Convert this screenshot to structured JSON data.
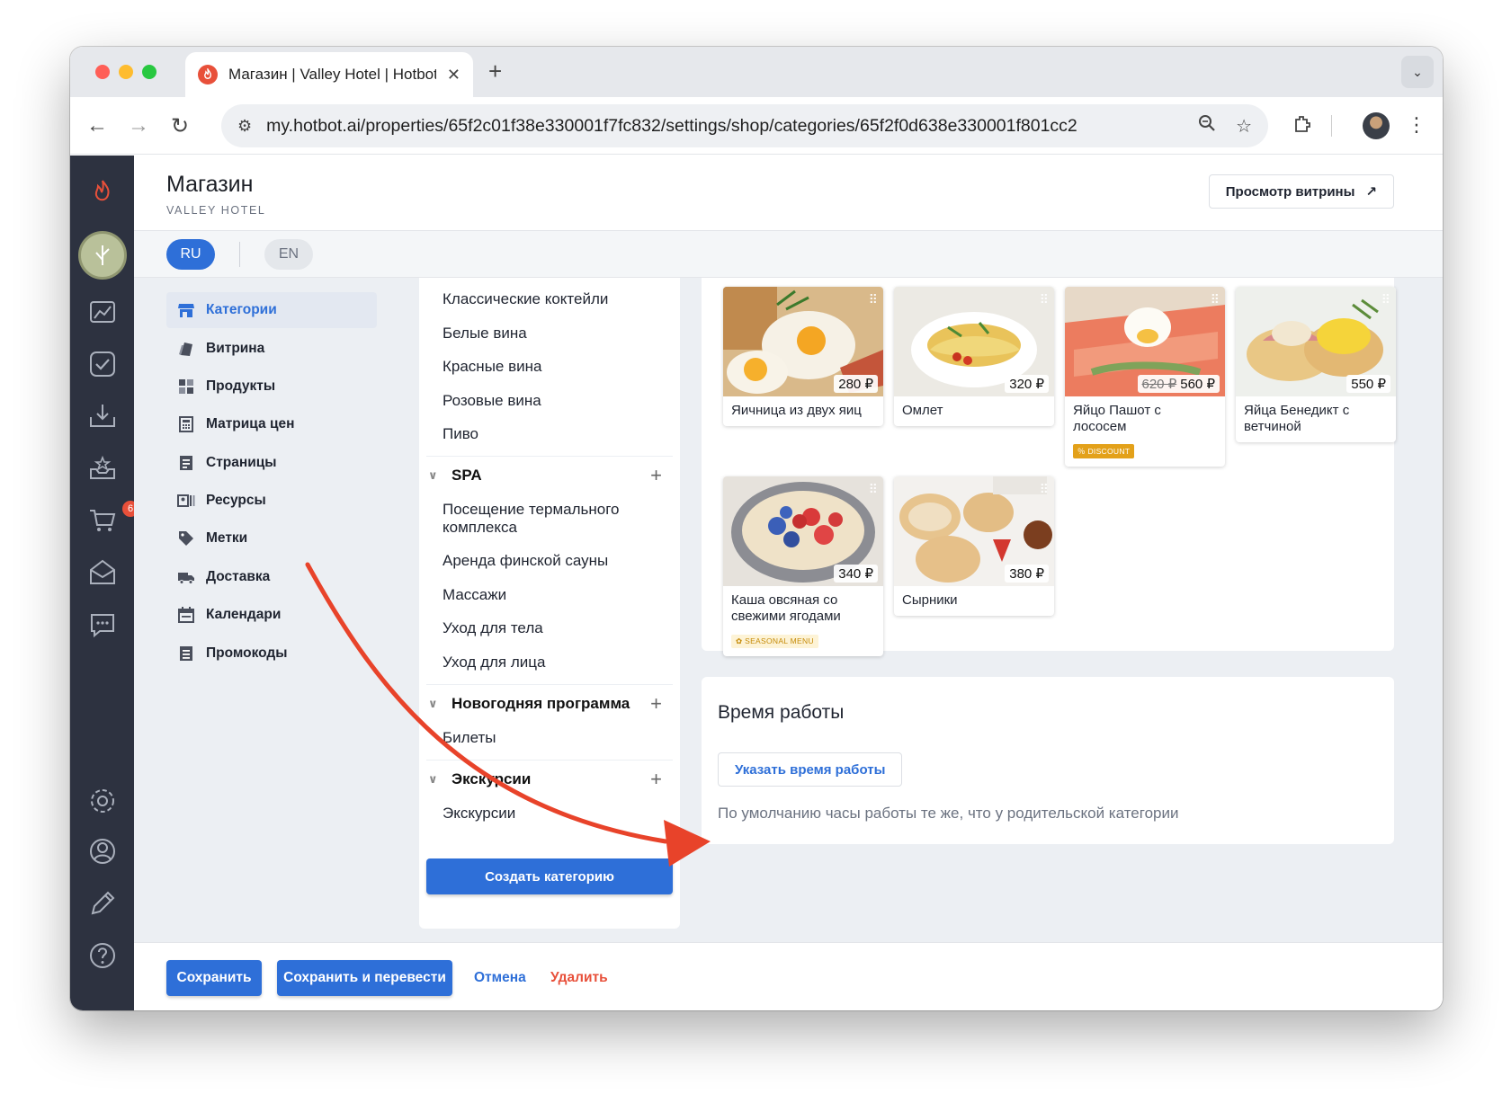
{
  "browser": {
    "tab_title": "Магазин | Valley Hotel | Hotbot",
    "url": "my.hotbot.ai/properties/65f2c01f38e330001f7fc832/settings/shop/categories/65f2f0d638e330001f801cc2"
  },
  "sidebar": {
    "cart_badge": "6"
  },
  "header": {
    "title": "Магазин",
    "subtitle": "VALLEY HOTEL",
    "preview_label": "Просмотр витрины"
  },
  "languages": {
    "active": "RU",
    "other": "EN"
  },
  "menu": {
    "items": [
      {
        "label": "Категории",
        "icon": "store-icon"
      },
      {
        "label": "Витрина",
        "icon": "showcase-icon"
      },
      {
        "label": "Продукты",
        "icon": "products-icon"
      },
      {
        "label": "Матрица цен",
        "icon": "calculator-icon"
      },
      {
        "label": "Страницы",
        "icon": "pages-icon"
      },
      {
        "label": "Ресурсы",
        "icon": "resources-icon"
      },
      {
        "label": "Метки",
        "icon": "tag-icon"
      },
      {
        "label": "Доставка",
        "icon": "truck-icon"
      },
      {
        "label": "Календари",
        "icon": "calendar-icon"
      },
      {
        "label": "Промокоды",
        "icon": "promo-icon"
      }
    ]
  },
  "categories": {
    "top_items": [
      "Классические коктейли",
      "Белые вина",
      "Красные вина",
      "Розовые вина",
      "Пиво"
    ],
    "groups": [
      {
        "name": "SPA",
        "items": [
          "Посещение термального комплекса",
          "Аренда финской сауны",
          "Массажи",
          "Уход для тела",
          "Уход для лица"
        ]
      },
      {
        "name": "Новогодняя программа",
        "items": [
          "Билеты"
        ]
      },
      {
        "name": "Экскурсии",
        "items": [
          "Экскурсии"
        ]
      }
    ],
    "create_label": "Создать категорию"
  },
  "products": [
    {
      "name": "Яичница из двух яиц",
      "price": "280 ₽",
      "old_price": "",
      "tag": ""
    },
    {
      "name": "Омлет",
      "price": "320 ₽",
      "old_price": "",
      "tag": ""
    },
    {
      "name": "Яйцо Пашот с лососем",
      "price": "560 ₽",
      "old_price": "620 ₽",
      "tag": "DISCOUNT"
    },
    {
      "name": "Яйца Бенедикт с ветчиной",
      "price": "550 ₽",
      "old_price": "",
      "tag": ""
    },
    {
      "name": "Каша овсяная со свежими ягодами",
      "price": "340 ₽",
      "old_price": "",
      "tag": "SEASONAL MENU"
    },
    {
      "name": "Сырники",
      "price": "380 ₽",
      "old_price": "",
      "tag": ""
    }
  ],
  "hours": {
    "title": "Время работы",
    "button": "Указать время работы",
    "note": "По умолчанию часы работы те же, что у родительской категории"
  },
  "footer": {
    "save": "Сохранить",
    "save_translate": "Сохранить и перевести",
    "cancel": "Отмена",
    "delete": "Удалить"
  },
  "colors": {
    "primary": "#2e6fd8",
    "danger": "#e8503a",
    "sidebar": "#2d3240",
    "annotation_arrow": "#e8432a"
  }
}
